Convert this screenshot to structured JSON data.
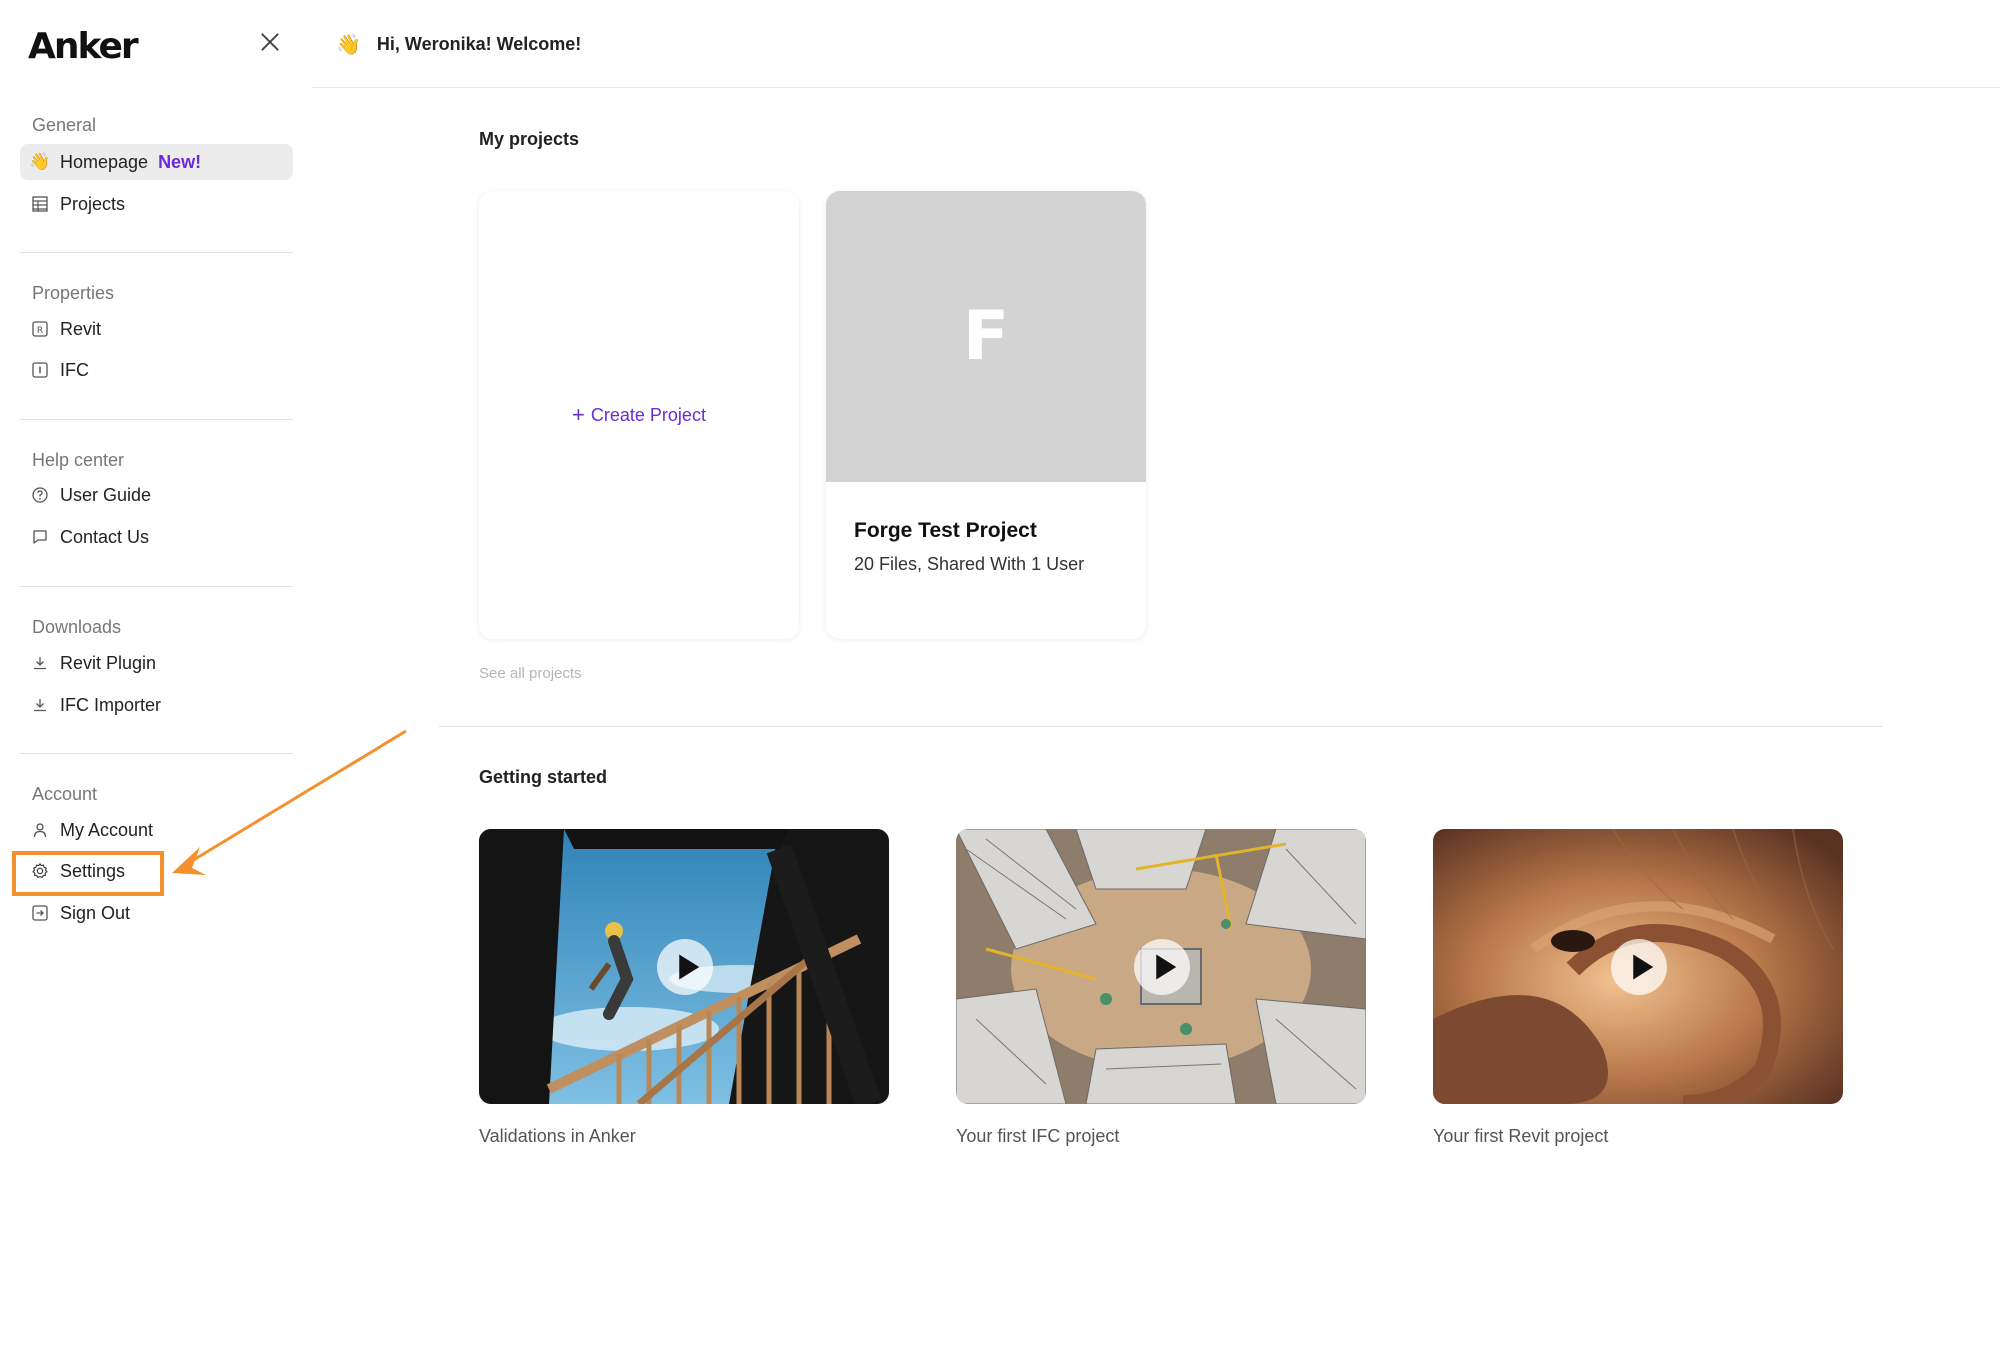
{
  "sidebar": {
    "logo": "Anker",
    "sections": {
      "general": {
        "title": "General",
        "homepage": "Homepage",
        "homepage_badge": "New!",
        "projects": "Projects"
      },
      "properties": {
        "title": "Properties",
        "revit": "Revit",
        "ifc": "IFC"
      },
      "help": {
        "title": "Help center",
        "user_guide": "User Guide",
        "contact": "Contact Us"
      },
      "downloads": {
        "title": "Downloads",
        "revit_plugin": "Revit Plugin",
        "ifc_importer": "IFC Importer"
      },
      "account": {
        "title": "Account",
        "my_account": "My Account",
        "settings": "Settings",
        "sign_out": "Sign Out"
      }
    }
  },
  "header": {
    "wave_icon": "👋",
    "welcome": "Hi, Weronika! Welcome!"
  },
  "main": {
    "my_projects": {
      "title": "My projects",
      "create_label": "Create Project",
      "create_icon": "+",
      "project": {
        "letter": "F",
        "name": "Forge Test Project",
        "meta": "20 Files, Shared With 1 User"
      },
      "see_all": "See all projects"
    },
    "getting_started": {
      "title": "Getting started",
      "videos": [
        {
          "caption": "Validations in Anker"
        },
        {
          "caption": "Your first IFC project"
        },
        {
          "caption": "Your first Revit project"
        }
      ]
    }
  },
  "colors": {
    "accent": "#6b2bd9",
    "annotation": "#f5912c"
  }
}
